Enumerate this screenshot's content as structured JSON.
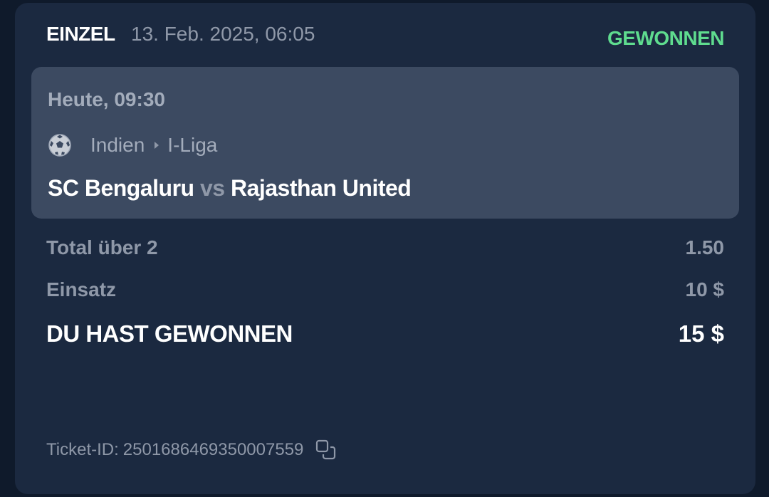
{
  "header": {
    "bet_type": "EINZEL",
    "date": "13. Feb. 2025, 06:05",
    "status": "GEWONNEN"
  },
  "event": {
    "time": "Heute, 09:30",
    "sport_icon": "soccer-ball-icon",
    "country": "Indien",
    "league": "I-Liga",
    "home_team": "SC Bengaluru",
    "vs": "vs",
    "away_team": "Rajasthan United"
  },
  "pick": {
    "label": "Total über 2",
    "odds": "1.50"
  },
  "stake": {
    "label": "Einsatz",
    "value": "10 $"
  },
  "win": {
    "label": "DU HAST GEWONNEN",
    "value": "15 $"
  },
  "ticket": {
    "label": "Ticket-ID:",
    "id": "2501686469350007559",
    "copy_icon": "copy-icon"
  },
  "colors": {
    "background": "#0f1a2b",
    "card": "#1b2940",
    "event_box": "#3c4a61",
    "status_won": "#5fdc8f",
    "text_primary": "#ffffff",
    "text_muted": "#8f98a8"
  }
}
